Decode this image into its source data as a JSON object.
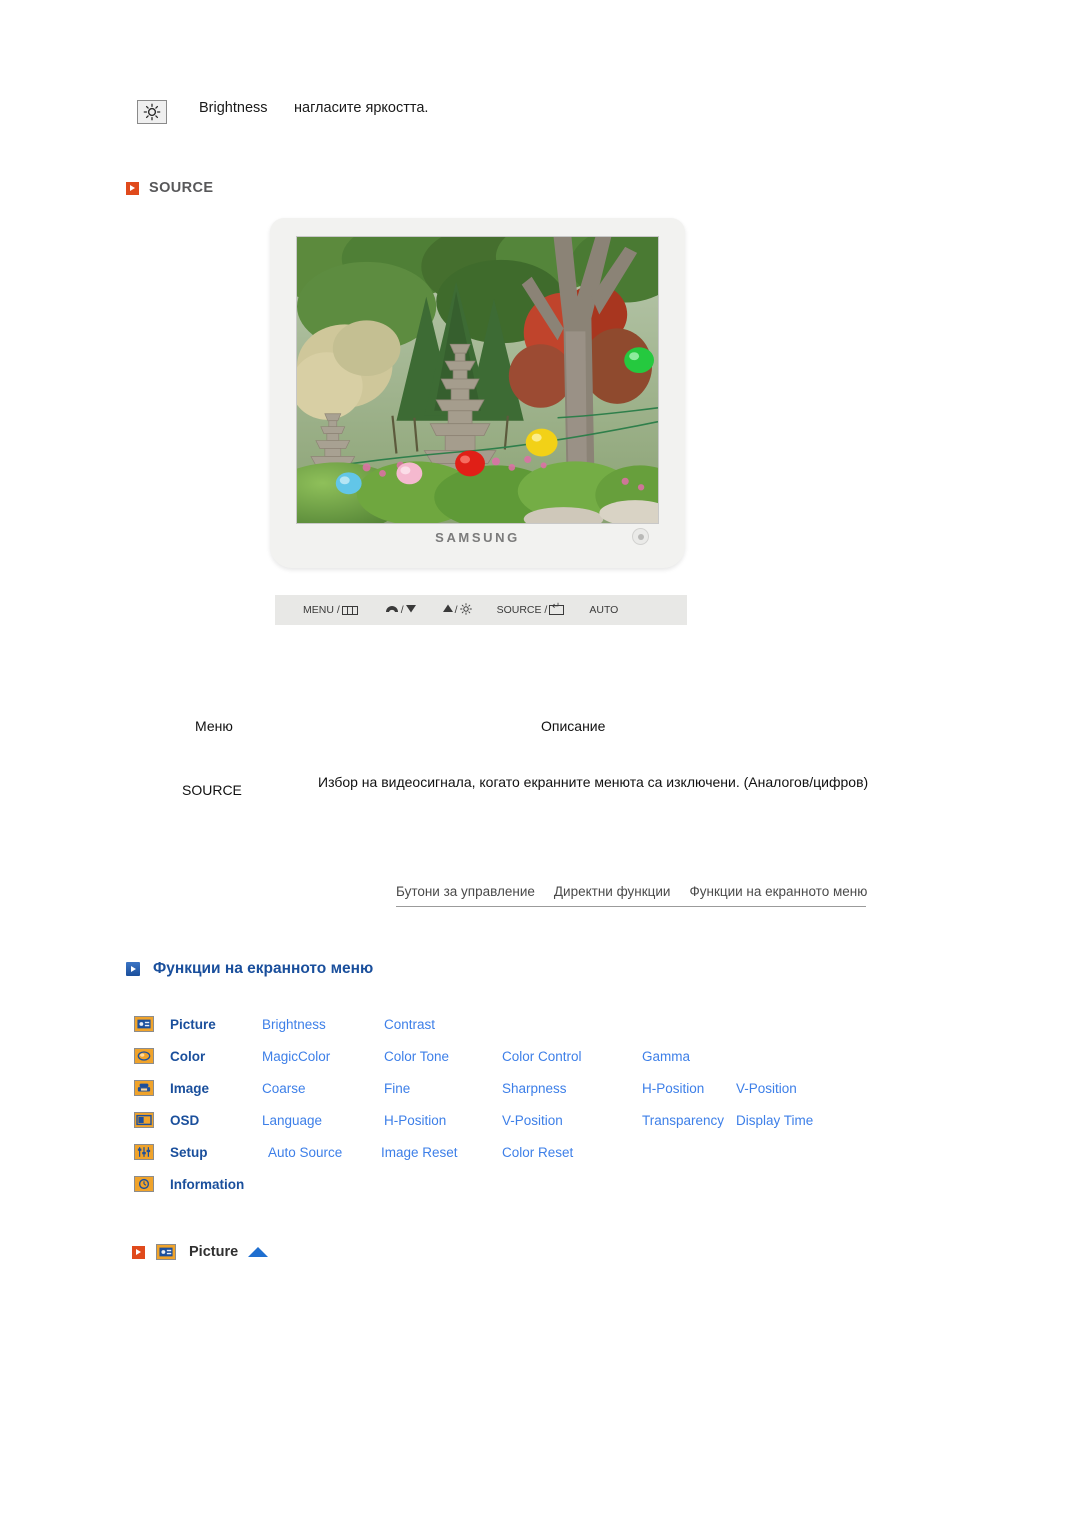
{
  "brightness_row": {
    "icon": "brightness-sun-icon",
    "label": "Brightness",
    "description": "нагласите яркостта."
  },
  "source_section": {
    "bullet": "red-arrow-bullet",
    "title": "SOURCE"
  },
  "monitor": {
    "brand": "SAMSUNG",
    "screen_content": "Japanese garden photo with stone pagoda, trees and colored paper lanterns",
    "power_button": "power-button",
    "control_bar": [
      {
        "label": "MENU /",
        "glyph": "menu-bars-icon"
      },
      {
        "label": "/",
        "glyph_before": "brightness-gauge-icon",
        "glyph_after": "down-triangle-icon"
      },
      {
        "label": "/",
        "glyph_before": "up-triangle-icon",
        "glyph_after": "sun-icon"
      },
      {
        "label": "SOURCE /",
        "glyph": "enter-return-icon"
      },
      {
        "label": "AUTO",
        "glyph": ""
      }
    ]
  },
  "description_table": {
    "headers": {
      "menu": "Меню",
      "description": "Описание"
    },
    "rows": [
      {
        "menu": "SOURCE",
        "description": "Избор на видеосигнала, когато екранните менюта са изключени. (Аналогов/цифров)"
      }
    ]
  },
  "tabs": [
    {
      "label": "Бутони за управление"
    },
    {
      "label": "Директни функции"
    },
    {
      "label": "Функции на екранното меню"
    }
  ],
  "section_heading": {
    "bullet": "blue-arrow-bullet",
    "title": "Функции на екранното меню"
  },
  "osd_table": {
    "rows": [
      {
        "icon": "picture-icon",
        "category": "Picture",
        "items": [
          "Brightness",
          "Contrast"
        ]
      },
      {
        "icon": "color-icon",
        "category": "Color",
        "items": [
          "MagicColor",
          "Color Tone",
          "Color Control",
          "Gamma"
        ]
      },
      {
        "icon": "image-icon",
        "category": "Image",
        "items": [
          "Coarse",
          "Fine",
          "Sharpness",
          "H-Position",
          "V-Position"
        ]
      },
      {
        "icon": "osd-icon",
        "category": "OSD",
        "items": [
          "Language",
          "H-Position",
          "V-Position",
          "Transparency",
          "Display Time"
        ]
      },
      {
        "icon": "setup-icon",
        "category": "Setup",
        "items": [
          "Auto Source",
          "Image Reset",
          "Color Reset"
        ]
      },
      {
        "icon": "information-icon",
        "category": "Information",
        "items": []
      }
    ]
  },
  "picture_heading": {
    "bullet": "red-arrow-bullet",
    "icon": "picture-icon",
    "title": "Picture",
    "top_arrow": "up-triangle-icon"
  },
  "colors": {
    "red_bullet": "#e04a1c",
    "blue_heading": "#1a4f9c",
    "link_blue": "#3d7fe8",
    "icon_orange": "#f0a32a",
    "source_gray": "#58585a"
  }
}
